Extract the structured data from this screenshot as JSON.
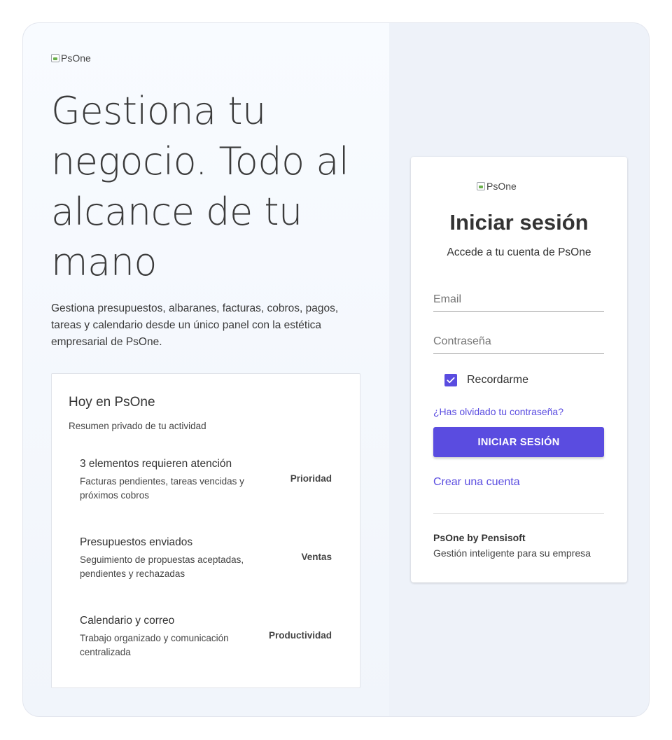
{
  "left": {
    "logo_alt": "PsOne",
    "hero_line1": "Gestiona tu",
    "hero_line2": "negocio. Todo al",
    "hero_line3": "alcance de tu",
    "hero_line4": "mano",
    "lede": "Gestiona presupuestos, albaranes, facturas, cobros, pagos, tareas y calendario desde un único panel con la estética empresarial de PsOne.",
    "panel": {
      "title": "Hoy en PsOne",
      "subtitle": "Resumen privado de tu actividad",
      "rows": [
        {
          "title": "3 elementos requieren atención",
          "description": "Facturas pendientes, tareas vencidas y próximos cobros",
          "tag": "Prioridad"
        },
        {
          "title": "Presupuestos enviados",
          "description": "Seguimiento de propuestas aceptadas, pendientes y rechazadas",
          "tag": "Ventas"
        },
        {
          "title": "Calendario y correo",
          "description": "Trabajo organizado y comunicación centralizada",
          "tag": "Productividad"
        }
      ]
    }
  },
  "login": {
    "logo_alt": "PsOne",
    "title": "Iniciar sesión",
    "subtitle": "Accede a tu cuenta de PsOne",
    "email_placeholder": "Email",
    "email_value": "",
    "password_placeholder": "Contraseña",
    "password_value": "",
    "remember_label": "Recordarme",
    "remember_checked": true,
    "forgot_label": "¿Has olvidado tu contraseña?",
    "submit_label": "INICIAR SESIÓN",
    "create_account_label": "Crear una cuenta",
    "brand": "PsOne by Pensisoft",
    "brand_tagline": "Gestión inteligente para su empresa"
  },
  "colors": {
    "accent": "#5a4ce0",
    "page_bg": "#eef2f9",
    "text": "#333333"
  }
}
